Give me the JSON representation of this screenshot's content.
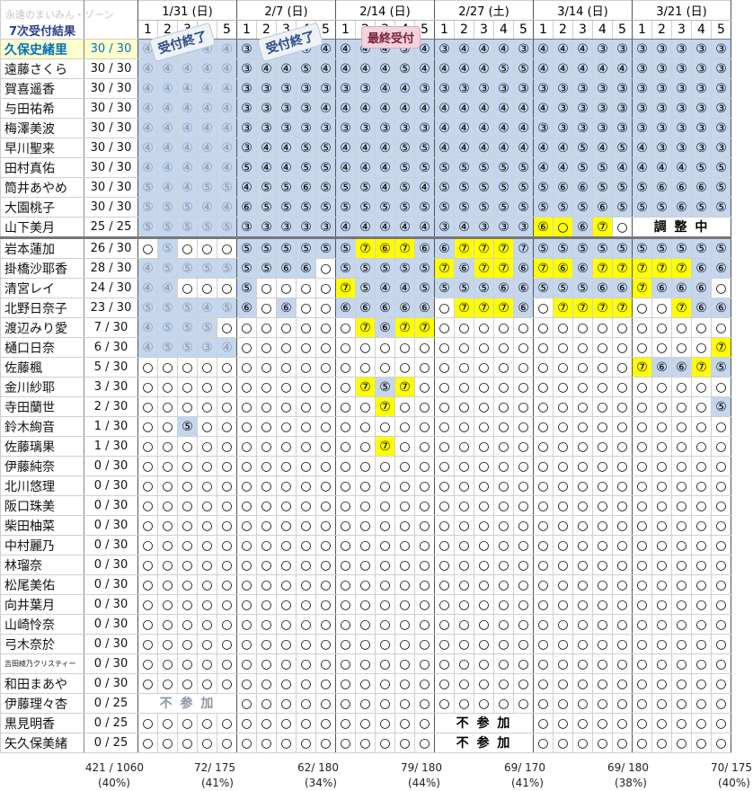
{
  "watermark": "永遠のまいみん・ゾーン",
  "title": "7次受付結果",
  "dates": [
    "1/31 (日)",
    "2/7 (日)",
    "2/14 (日)",
    "2/27 (土)",
    "3/14 (日)",
    "3/21 (日)"
  ],
  "session_labels": [
    "1",
    "2",
    "3",
    "4",
    "5"
  ],
  "stamps": {
    "closed": "受付終了",
    "final": "最終受付"
  },
  "members": [
    {
      "name": "久保史緒里",
      "count": "30 / 30",
      "sessions": "44444 34444 44454 34443 44433 33333"
    },
    {
      "name": "遠藤さくら",
      "count": "30 / 30",
      "sessions": "44444 34454 44454 44455 44444 33333"
    },
    {
      "name": "賀喜遥香",
      "count": "30 / 30",
      "sessions": "44444 33333 33443 33333 33333 33333"
    },
    {
      "name": "与田祐希",
      "count": "30 / 30",
      "sessions": "44444 33334 44444 44444 43333 33333"
    },
    {
      "name": "梅澤美波",
      "count": "30 / 30",
      "sessions": "44444 33333 33333 44444 33333 33333"
    },
    {
      "name": "早川聖来",
      "count": "30 / 30",
      "sessions": "44444 34455 44455 44444 44545 43333"
    },
    {
      "name": "田村真佑",
      "count": "30 / 30",
      "sessions": "44444 54455 44455 55555 44554 44455"
    },
    {
      "name": "筒井あやめ",
      "count": "30 / 30",
      "sessions": "54455 45565 55454 55555 56655 56665"
    },
    {
      "name": "大園桃子",
      "count": "30 / 30",
      "sessions": "55544 65555 55555 55555 55565 55655"
    },
    {
      "name": "山下美月",
      "count": "25 / 25",
      "sessions": "55555 33333 44444 34333 Y6YY6Y7 ...."
    },
    {
      "name": "岩本蓮加",
      "count": "26 / 30",
      "sessions": "05000 55555 5Y7Y6Y76 6Y7Y7Y77 55555 55555"
    },
    {
      "name": "掛橋沙耶香",
      "count": "28 / 30",
      "sessions": "45555 55660 55555 Y76Y7Y76 Y7Y66Y7Y7 Y7Y7Y766"
    },
    {
      "name": "清宮レイ",
      "count": "24 / 30",
      "sessions": "44000 50000 Y75445 55566 55566 Y7666"
    },
    {
      "name": "北野日奈子",
      "count": "23 / 30",
      "sessions": "55545 60600 66666 0Y7Y7Y76Y7 0Y7Y7Y7Y7 00Y766"
    },
    {
      "name": "渡辺みり愛",
      "count": "7 / 30",
      "sessions": "45550 00000 0Y76Y7Y7 00000 00000 00000"
    },
    {
      "name": "樋口日奈",
      "count": "6 / 30",
      "sessions": "45534 00000 00000 00000 00000 0000Y7"
    },
    {
      "name": "佐藤楓",
      "count": "5 / 30",
      "sessions": "00000 00000 00000 00000 00000 Y766Y75"
    },
    {
      "name": "金川紗耶",
      "count": "3 / 30",
      "sessions": "00000 00000 0Y75Y70 00000 00000 00000"
    },
    {
      "name": "寺田蘭世",
      "count": "2 / 30",
      "sessions": "00000 00000 00Y700 00000 00000 00005"
    },
    {
      "name": "鈴木絢音",
      "count": "1 / 30",
      "sessions": "00500 00000 00000 00000 00000 00000"
    },
    {
      "name": "佐藤璃果",
      "count": "1 / 30",
      "sessions": "00000 00000 00Y700 00000 00000 00000"
    },
    {
      "name": "伊藤純奈",
      "count": "0 / 30",
      "sessions": "00000 00000 00000 00000 00000 00000"
    },
    {
      "name": "北川悠理",
      "count": "0 / 30",
      "sessions": "00000 00000 00000 00000 00000 00000"
    },
    {
      "name": "阪口珠美",
      "count": "0 / 30",
      "sessions": "00000 00000 00000 00000 00000 00000"
    },
    {
      "name": "柴田柚菜",
      "count": "0 / 30",
      "sessions": "00000 00000 00000 00000 00000 00000"
    },
    {
      "name": "中村麗乃",
      "count": "0 / 30",
      "sessions": "00000 00000 00000 00000 00000 00000"
    },
    {
      "name": "林瑠奈",
      "count": "0 / 30",
      "sessions": "00000 00000 00000 00000 00000 00000"
    },
    {
      "name": "松尾美佑",
      "count": "0 / 30",
      "sessions": "00000 00000 00000 00000 00000 00000"
    },
    {
      "name": "向井葉月",
      "count": "0 / 30",
      "sessions": "00000 00000 00000 00000 00000 00000"
    },
    {
      "name": "山崎怜奈",
      "count": "0 / 30",
      "sessions": "00000 00000 00000 00000 00000 00000"
    },
    {
      "name": "弓木奈於",
      "count": "0 / 30",
      "sessions": "00000 00000 00000 00000 00000 00000"
    },
    {
      "name": "吉田綾乃クリスティー",
      "count": "0 / 30",
      "sessions": "00000 00000 00000 00000 00000 00000"
    },
    {
      "name": "和田まあや",
      "count": "0 / 30",
      "sessions": "00000 00000 00000 00000 00000 00000"
    },
    {
      "name": "伊藤理々杏",
      "count": "0 / 25",
      "sessions": "..... 00000 00000 00000 00000 00000"
    },
    {
      "name": "黒見明香",
      "count": "0 / 25",
      "sessions": "00000 00000 00000 ..... 00000 00000"
    },
    {
      "name": "矢久保美緒",
      "count": "0 / 25",
      "sessions": "00000 00000 00000 ..... 00000 00000"
    }
  ],
  "notes": {
    "adjusting": "調 整 中",
    "not_participating": "不 参 加"
  },
  "totals": {
    "overall": "421 / 1060",
    "overall_pct": "(40%)",
    "per_date": [
      {
        "value": "72/ 175",
        "pct": "(41%)"
      },
      {
        "value": "62/ 180",
        "pct": "(34%)"
      },
      {
        "value": "79/ 180",
        "pct": "(44%)"
      },
      {
        "value": "69/ 170",
        "pct": "(41%)"
      },
      {
        "value": "69/ 180",
        "pct": "(38%)"
      },
      {
        "value": "70/ 175",
        "pct": "(40%)"
      }
    ]
  }
}
